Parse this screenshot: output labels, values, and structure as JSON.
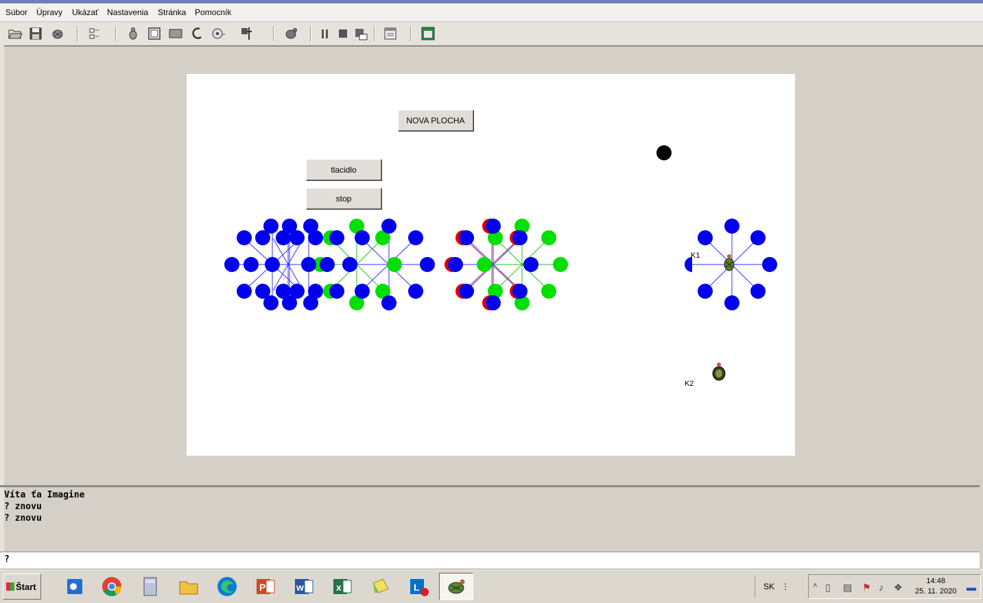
{
  "menu": [
    "Súbor",
    "Úpravy",
    "Ukázať",
    "Nastavenia",
    "Stránka",
    "Pomocník"
  ],
  "toolbar_icons": [
    "open-folder-icon",
    "save-icon",
    "turtle-bird-icon",
    "layout-icon",
    "turtle-add-icon",
    "window-icon",
    "rectangle-icon",
    "paint-icon",
    "text-icon",
    "media-icon",
    "tools-icon",
    "turtle-run-icon",
    "pause-icon",
    "stop-icon",
    "run-icon",
    "page-icon",
    "green-window-icon"
  ],
  "page": {
    "buttons": {
      "nova_plocha": "NOVA PLOCHA",
      "tlacidlo": "tlacidlo",
      "stop": "stop"
    },
    "labels": {
      "k1": "K1",
      "k2": "K2"
    },
    "colors": {
      "blue": "#0000ee",
      "green": "#00e000",
      "red": "#e00000",
      "black": "#000000"
    }
  },
  "console": {
    "lines": [
      "Víta ťa Imagine",
      "? znovu",
      "? znovu"
    ]
  },
  "command_line": {
    "prompt": "?"
  },
  "taskbar": {
    "start_label": "Štart",
    "apps": [
      "outlook-icon",
      "chrome-icon",
      "calculator-icon",
      "file-explorer-icon",
      "edge-icon",
      "powerpoint-icon",
      "word-icon",
      "excel-icon",
      "sticky-notes-icon",
      "lync-icon",
      "imagine-turtle-icon"
    ],
    "lang": "SK",
    "time": "14:48",
    "date": "25. 11. 2020"
  }
}
